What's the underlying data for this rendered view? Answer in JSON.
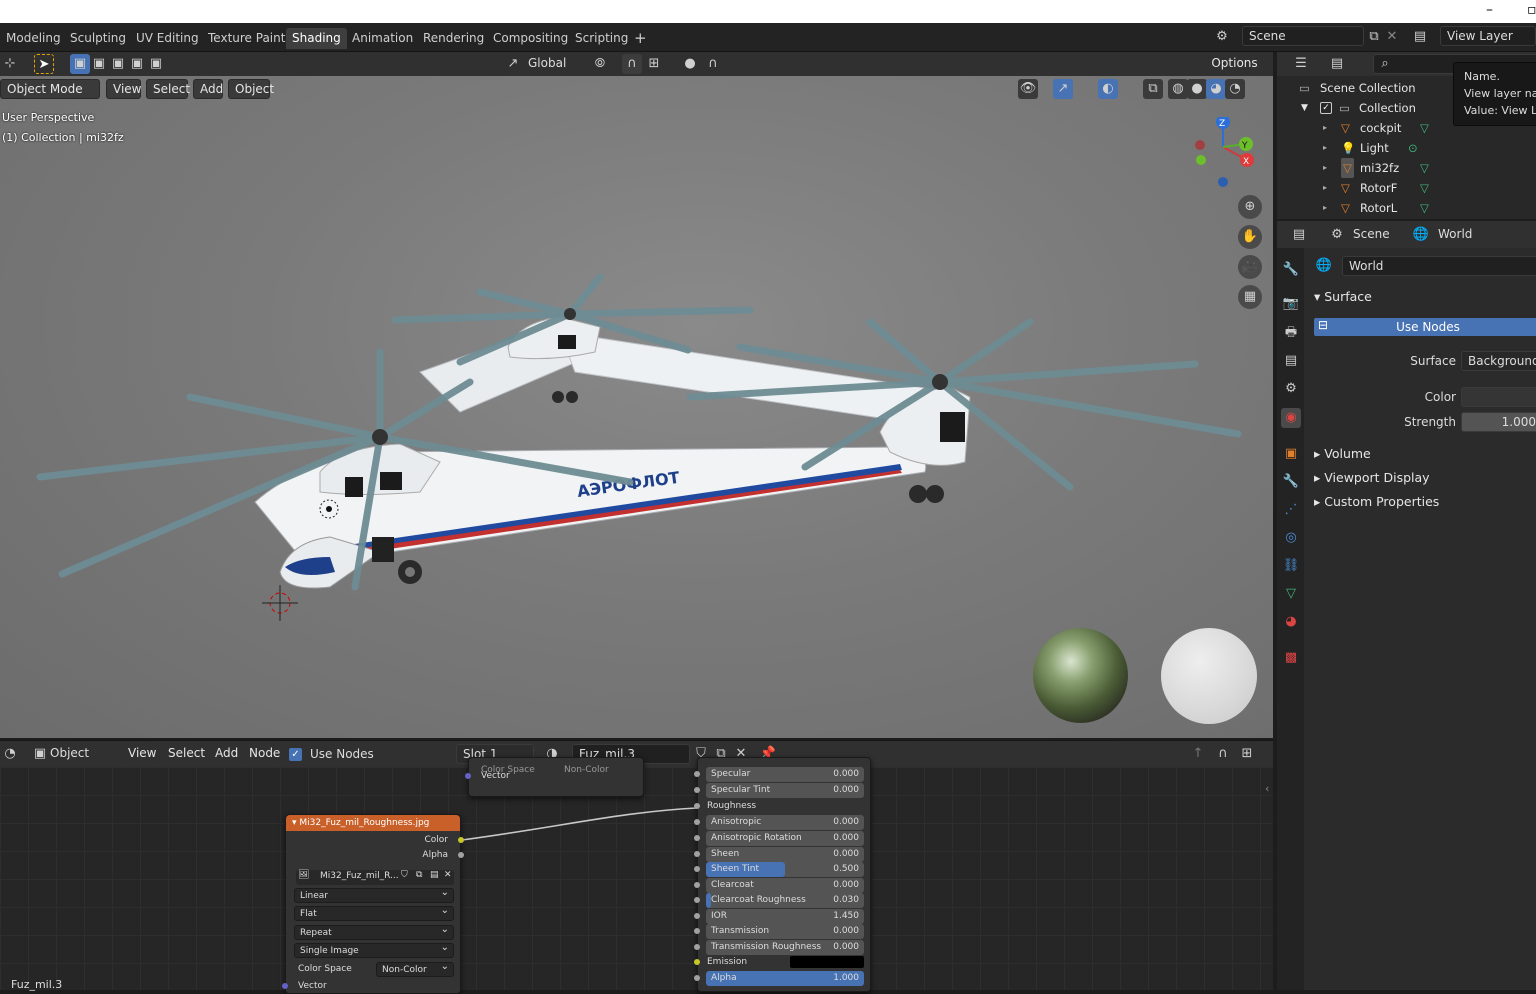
{
  "window": {
    "minimize": "–",
    "maximize": "▫"
  },
  "workspaces": [
    "Modeling",
    "Sculpting",
    "UV Editing",
    "Texture Paint",
    "Shading",
    "Animation",
    "Rendering",
    "Compositing",
    "Scripting"
  ],
  "active_workspace": "Shading",
  "add_tab": "+",
  "scene_field": "Scene",
  "view_layer_field": "View Layer",
  "viewport": {
    "orientation": "Global",
    "options": "Options",
    "mode": "Object Mode",
    "menus": [
      "View",
      "Select",
      "Add",
      "Object"
    ],
    "overlay_line1": "User Perspective",
    "overlay_line2": "(1) Collection | mi32fz",
    "fuselage_text": "АЭРОФЛОТ",
    "gizmo": {
      "z": "Z",
      "y": "Y",
      "x": "X"
    }
  },
  "node_editor": {
    "type": "Object",
    "menus": [
      "View",
      "Select",
      "Add",
      "Node"
    ],
    "use_nodes_label": "Use Nodes",
    "use_nodes_checked": true,
    "slot": "Slot 1",
    "material": "Fuz_mil.3",
    "footer_label": "Fuz_mil.3",
    "partial_node": {
      "row1_label": "Color Space",
      "row1_value": "Non-Color",
      "row2": "Vector"
    },
    "image_node": {
      "title": "Mi32_Fuz_mil_Roughness.jpg",
      "out_color": "Color",
      "out_alpha": "Alpha",
      "image_name": "Mi32_Fuz_mil_R...",
      "interpolation": "Linear",
      "projection": "Flat",
      "extension": "Repeat",
      "source": "Single Image",
      "color_space_label": "Color Space",
      "color_space_value": "Non-Color",
      "vector": "Vector"
    },
    "bsdf_rows": [
      {
        "label": "Specular",
        "value": "0.000",
        "fill": 0
      },
      {
        "label": "Specular Tint",
        "value": "0.000",
        "fill": 0
      },
      {
        "label": "Roughness",
        "value": "",
        "fill": 0,
        "linked": true
      },
      {
        "label": "Anisotropic",
        "value": "0.000",
        "fill": 0
      },
      {
        "label": "Anisotropic Rotation",
        "value": "0.000",
        "fill": 0
      },
      {
        "label": "Sheen",
        "value": "0.000",
        "fill": 0
      },
      {
        "label": "Sheen Tint",
        "value": "0.500",
        "fill": 0.5
      },
      {
        "label": "Clearcoat",
        "value": "0.000",
        "fill": 0
      },
      {
        "label": "Clearcoat Roughness",
        "value": "0.030",
        "fill": 0.03
      },
      {
        "label": "IOR",
        "value": "1.450",
        "fill": 0
      },
      {
        "label": "Transmission",
        "value": "0.000",
        "fill": 0
      },
      {
        "label": "Transmission Roughness",
        "value": "0.000",
        "fill": 0
      },
      {
        "label": "Emission",
        "value": "",
        "fill": 0,
        "color": "#000000"
      },
      {
        "label": "Alpha",
        "value": "1.000",
        "fill": 1
      }
    ]
  },
  "outliner": {
    "search_placeholder": "",
    "scene_collection": "Scene Collection",
    "collection": "Collection",
    "items": [
      "cockpit",
      "Light",
      "mi32fz",
      "RotorF",
      "RotorL"
    ]
  },
  "tooltip": {
    "line1": "Name.",
    "line2": "View layer name",
    "line3": "Value: View Layer"
  },
  "properties": {
    "breadcrumb_scene": "Scene",
    "breadcrumb_world": "World",
    "world_name": "World",
    "surface_panel": "Surface",
    "use_nodes_button": "Use Nodes",
    "surface_label": "Surface",
    "surface_value": "Background",
    "color_label": "Color",
    "strength_label": "Strength",
    "strength_value": "1.000",
    "collapsed_panels": [
      "Volume",
      "Viewport Display",
      "Custom Properties"
    ]
  },
  "colors": {
    "accent": "#4772b3",
    "orange_header": "#c9602a",
    "green_icon": "#3fb47a",
    "selected_row": "#334d80"
  }
}
